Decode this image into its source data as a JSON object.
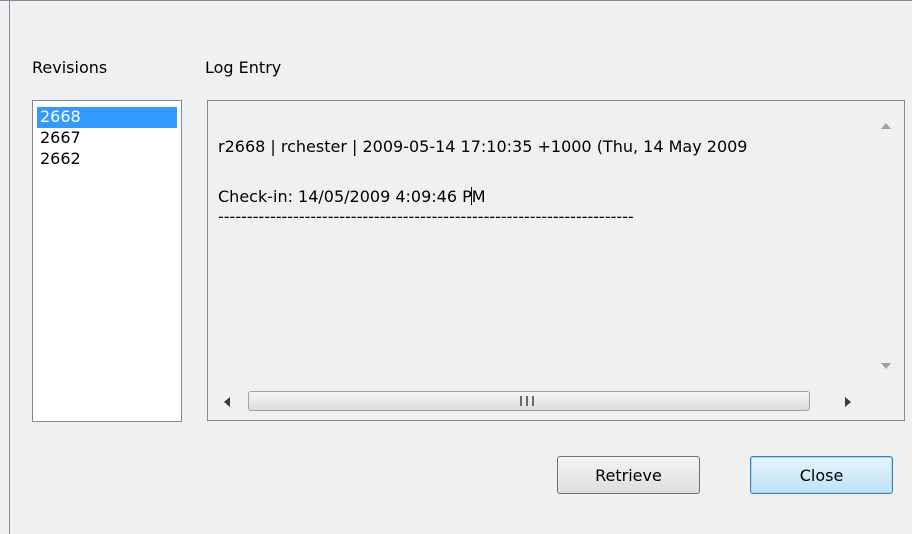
{
  "labels": {
    "revisions": "Revisions",
    "log_entry": "Log Entry"
  },
  "revisions": [
    {
      "label": "2668",
      "selected": true
    },
    {
      "label": "2667",
      "selected": false
    },
    {
      "label": "2662",
      "selected": false
    }
  ],
  "log": {
    "header_line": "r2668 | rchester | 2009-05-14 17:10:35 +1000 (Thu, 14 May 2009",
    "message_before_caret": "Check-in: 14/05/2009 4:09:46 P",
    "message_after_caret": "M",
    "separator": "------------------------------------------------------------------------"
  },
  "buttons": {
    "retrieve": "Retrieve",
    "close": "Close"
  },
  "icons": {
    "scroll_up": "arrow-up-icon",
    "scroll_down": "arrow-down-icon",
    "scroll_left": "arrow-left-icon",
    "scroll_right": "arrow-right-icon",
    "grip": "grip-icon"
  },
  "colors": {
    "selection": "#3399ff",
    "default_button_border": "#3c7fb1"
  }
}
